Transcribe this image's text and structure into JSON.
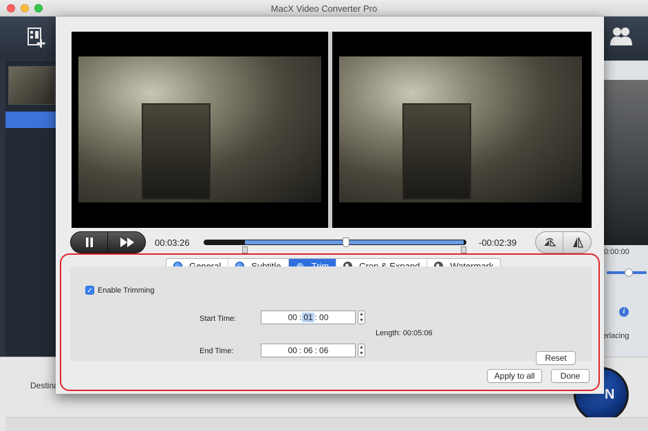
{
  "window": {
    "title": "MacX Video Converter Pro"
  },
  "background": {
    "timecode": "0:00:00",
    "deinterlacing_label": "erlacing",
    "destination_label": "Destina",
    "run_label": "N"
  },
  "dialog": {
    "playback": {
      "current_time": "00:03:26",
      "remaining_time": "-00:02:39"
    },
    "tabs": [
      {
        "label": "General",
        "active": false,
        "dot": "blue"
      },
      {
        "label": "Subtitle",
        "active": false,
        "dot": "blue"
      },
      {
        "label": "Trim",
        "active": true,
        "dot": "blue"
      },
      {
        "label": "Crop & Expand",
        "active": false,
        "dot": "grey"
      },
      {
        "label": "Watermark",
        "active": false,
        "dot": "grey"
      }
    ],
    "trim": {
      "enable_label": "Enable Trimming",
      "enabled": true,
      "start_label": "Start Time:",
      "start": {
        "hh": "00",
        "mm": "01",
        "ss": "00"
      },
      "end_label": "End Time:",
      "end": {
        "hh": "00",
        "mm": "06",
        "ss": "06"
      },
      "length_text": "Length:  00:05:06",
      "reset_label": "Reset"
    },
    "apply_all_label": "Apply to all",
    "done_label": "Done"
  },
  "colors": {
    "accent": "#2f6fe0",
    "highlight_border": "#e0262b",
    "selected_range": "#6b9ae3"
  },
  "icons": {
    "pause": "pause-icon",
    "fast_forward": "fast-forward-icon",
    "flip_horizontal": "flip-horizontal-icon",
    "flip_vertical": "flip-vertical-icon",
    "add_video": "add-video-icon",
    "people": "people-icon",
    "info": "info-icon"
  }
}
